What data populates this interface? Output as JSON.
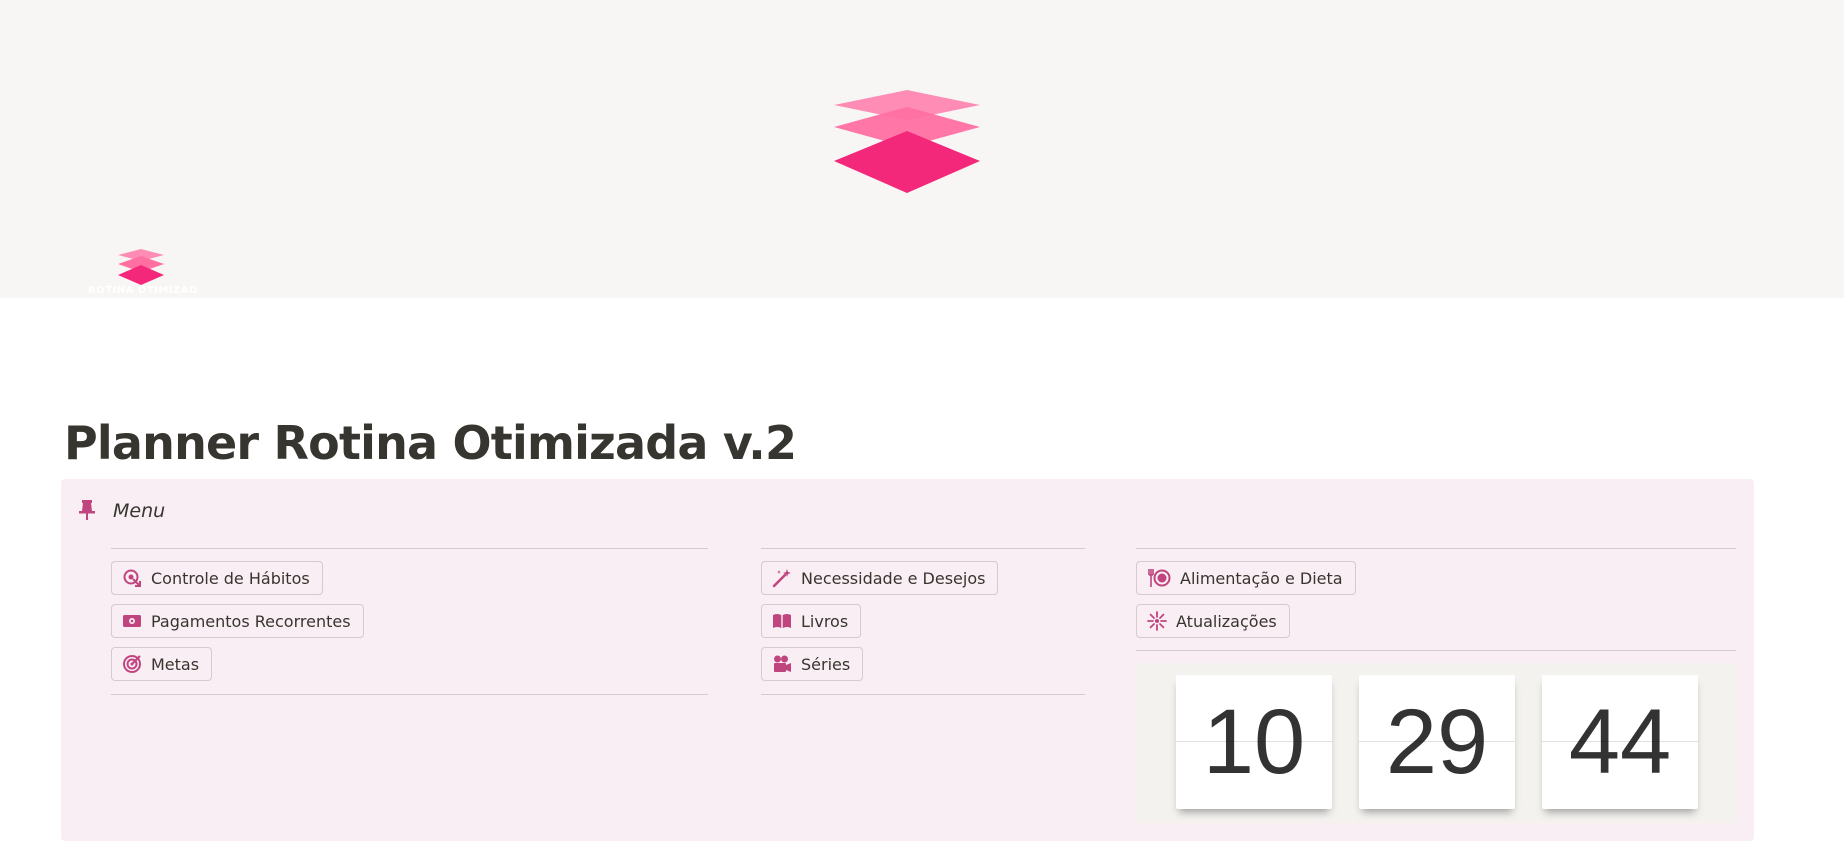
{
  "cover": {
    "logo_icon": "stacked-layers-icon"
  },
  "page_icon": {
    "icon": "stacked-layers-icon",
    "caption": "ROTINA OTIMIZADA"
  },
  "page": {
    "title": "Planner Rotina Otimizada v.2"
  },
  "callout": {
    "icon": "pushpin-icon",
    "title": "Menu",
    "columns": [
      {
        "items": [
          {
            "label": "Controle de Hábitos",
            "icon": "target-arrow-icon"
          },
          {
            "label": "Pagamentos Recorrentes",
            "icon": "money-bill-icon"
          },
          {
            "label": "Metas",
            "icon": "bullseye-icon"
          }
        ]
      },
      {
        "items": [
          {
            "label": "Necessidade e Desejos",
            "icon": "magic-wand-icon"
          },
          {
            "label": "Livros",
            "icon": "open-book-icon"
          },
          {
            "label": "Séries",
            "icon": "film-camera-icon"
          }
        ]
      },
      {
        "items": [
          {
            "label": "Alimentação e Dieta",
            "icon": "plate-utensils-icon"
          },
          {
            "label": "Atualizações",
            "icon": "sparkle-burst-icon"
          }
        ]
      }
    ]
  },
  "clock": {
    "hours": "10",
    "minutes": "29",
    "seconds": "44"
  },
  "colors": {
    "accent": "#f0287a",
    "icon": "#c0457f",
    "callout_bg": "#f9eef3",
    "cover_bg": "#f8f6f5"
  }
}
